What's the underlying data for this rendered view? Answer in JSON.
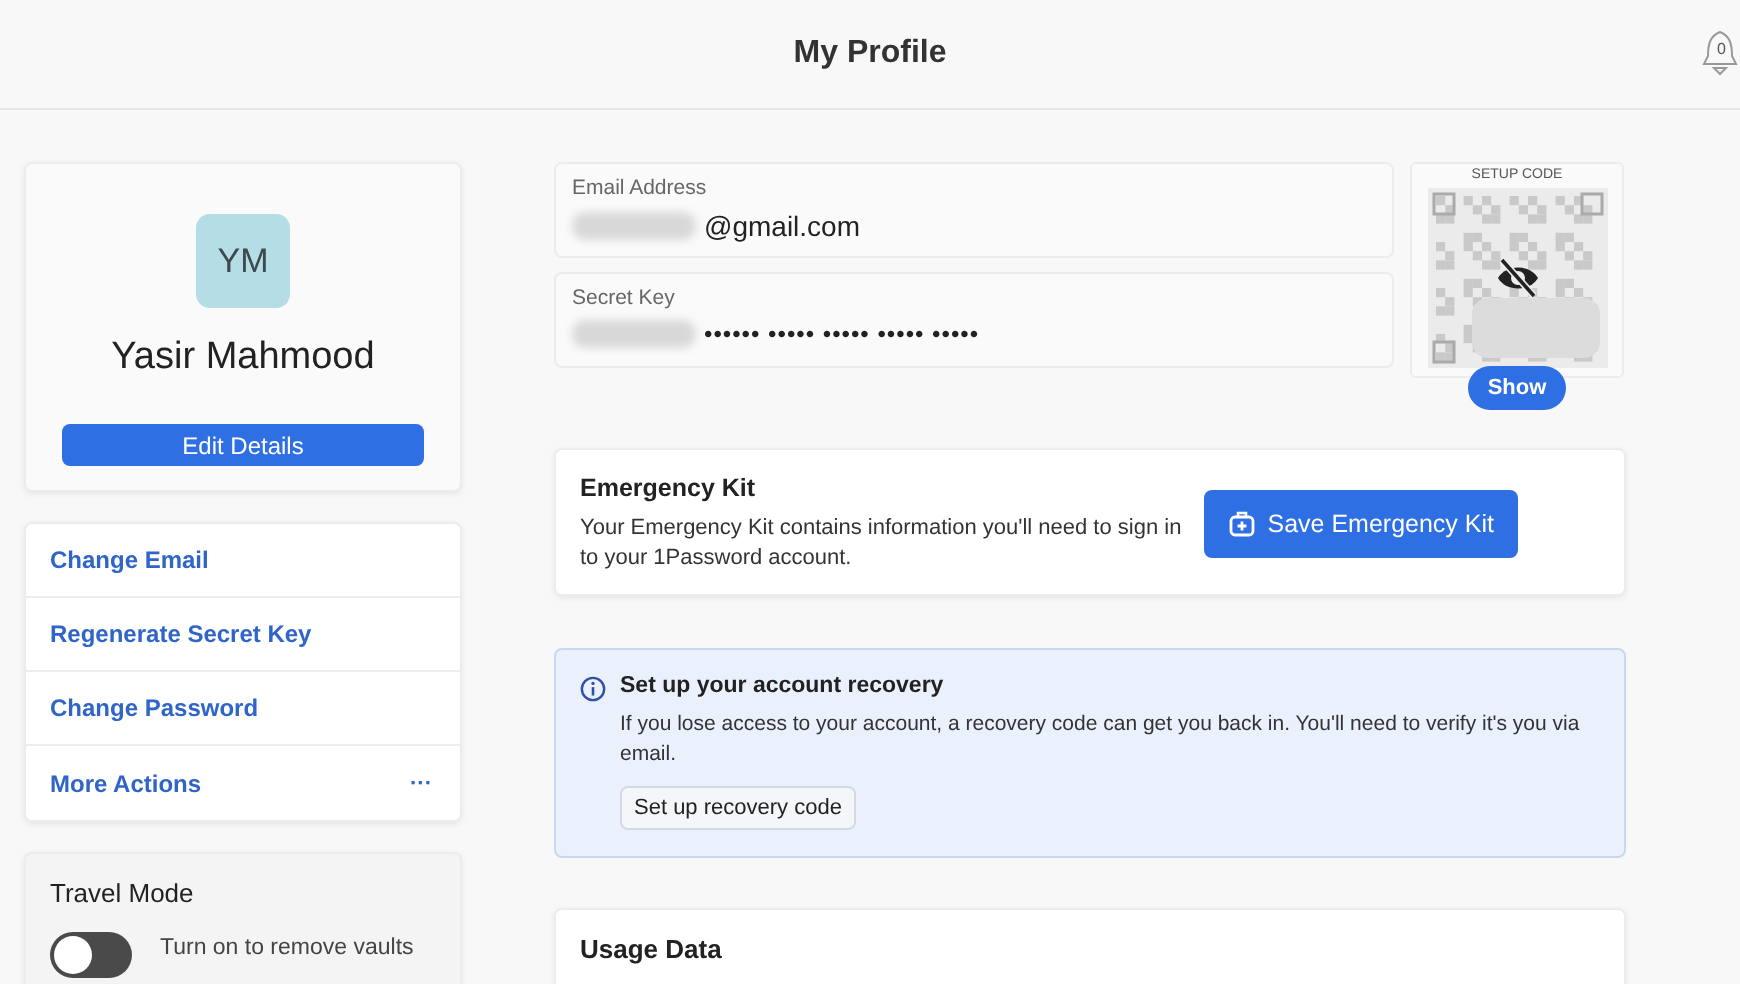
{
  "header": {
    "title": "My Profile",
    "notifications": "0"
  },
  "profile": {
    "initials": "YM",
    "name": "Yasir Mahmood",
    "edit_button": "Edit Details"
  },
  "actions": [
    {
      "label": "Change Email",
      "kind": "link"
    },
    {
      "label": "Regenerate Secret Key",
      "kind": "link"
    },
    {
      "label": "Change Password",
      "kind": "link"
    },
    {
      "label": "More Actions",
      "kind": "menu",
      "menu_icon": "···"
    }
  ],
  "travel_mode": {
    "title": "Travel Mode",
    "on": false,
    "description": "Turn on to remove vaults"
  },
  "account_fields": [
    {
      "label": "Email Address",
      "value": "@gmail.com",
      "kind": "email"
    },
    {
      "label": "Secret Key",
      "value": "•••••• ••••• ••••• ••••• •••••",
      "kind": "secret"
    }
  ],
  "setup_code": {
    "title": "SETUP CODE",
    "button": "Show"
  },
  "emergency_kit": {
    "title": "Emergency Kit",
    "description": "Your Emergency Kit contains information you'll need to sign in to your 1Password account.",
    "button": "Save Emergency Kit"
  },
  "recovery": {
    "title": "Set up your account recovery",
    "description": "If you lose access to your account, a recovery code can get you back in. You'll need to verify it's you via email.",
    "button": "Set up recovery code"
  },
  "usage": {
    "title": "Usage Data"
  }
}
